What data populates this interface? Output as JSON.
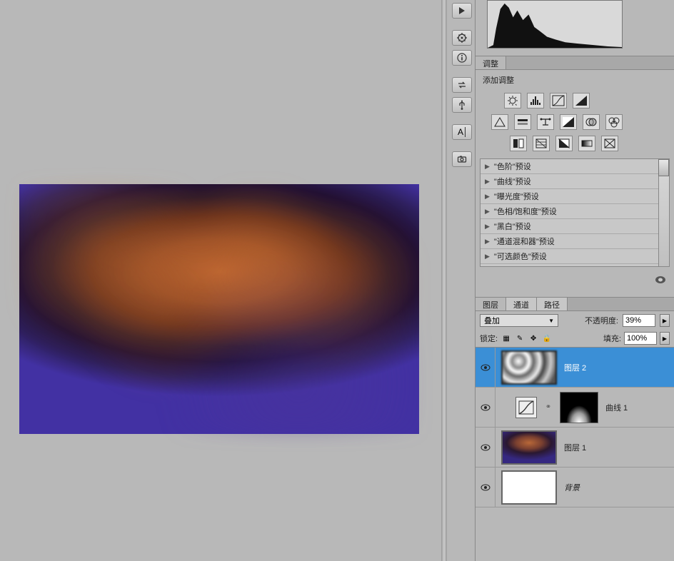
{
  "toolbar": {
    "icons": [
      "play-icon",
      "helm-icon",
      "info-icon",
      "swap-icon",
      "usb-icon",
      "text-icon",
      "camera-icon"
    ]
  },
  "adjustments": {
    "tab_label": "调整",
    "title": "添加调整",
    "presets": [
      "\"色阶\"预设",
      "\"曲线\"预设",
      "\"曝光度\"预设",
      "\"色相/饱和度\"预设",
      "\"黑白\"预设",
      "\"通道混和器\"预设",
      "\"可选颜色\"预设"
    ]
  },
  "layers": {
    "tabs": [
      "图层",
      "通道",
      "路径"
    ],
    "blend_mode": "叠加",
    "opacity_label": "不透明度:",
    "opacity_value": "39%",
    "lock_label": "锁定:",
    "fill_label": "填充:",
    "fill_value": "100%",
    "items": [
      {
        "name": "图层 2",
        "type": "clouds"
      },
      {
        "name": "曲线 1",
        "type": "curves"
      },
      {
        "name": "图层 1",
        "type": "gradient"
      },
      {
        "name": "背景",
        "type": "white"
      }
    ]
  }
}
